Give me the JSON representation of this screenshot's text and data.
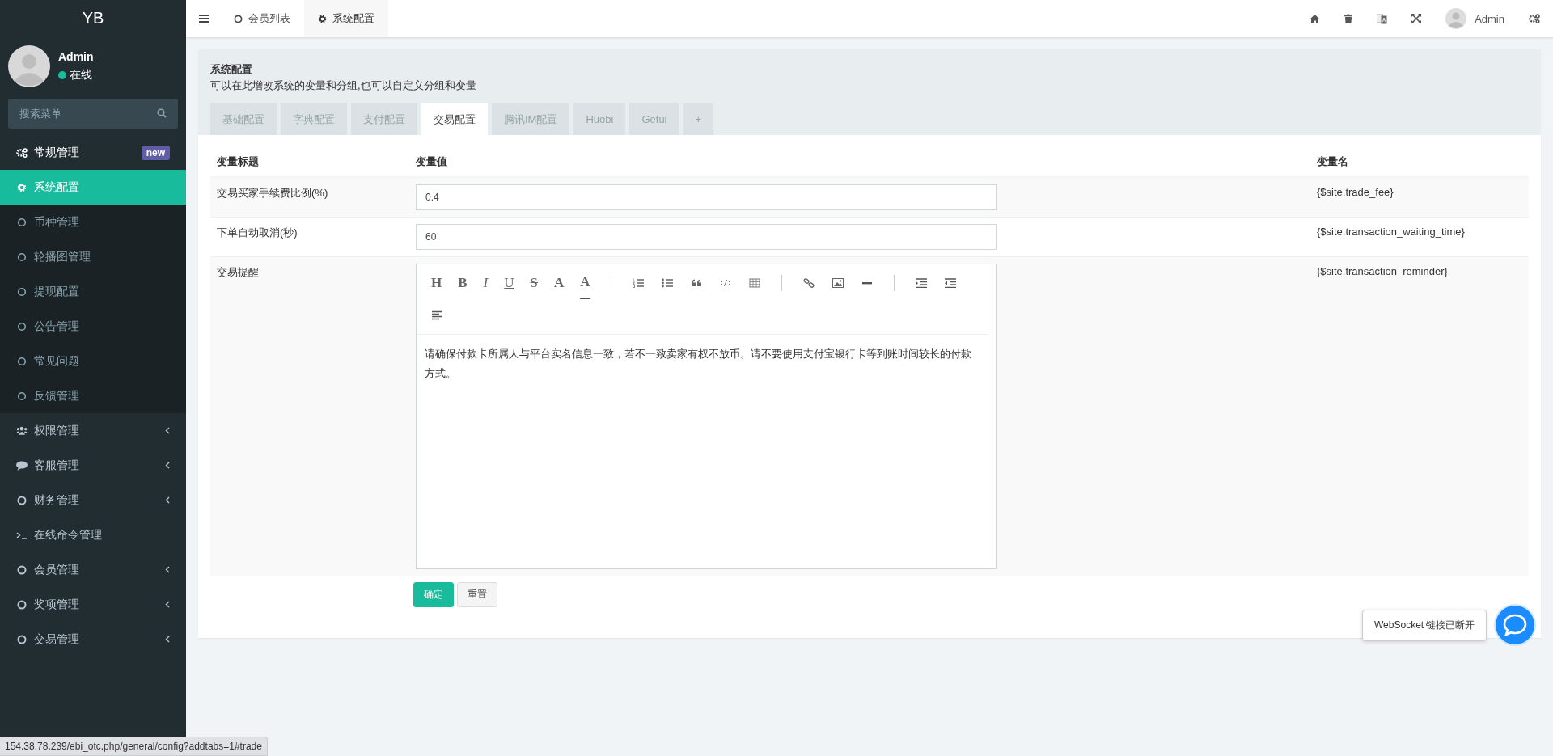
{
  "sidebar": {
    "logo": "YB",
    "user": {
      "name": "Admin",
      "status": "在线",
      "online": true
    },
    "search": {
      "placeholder": "搜索菜单"
    },
    "menu": [
      {
        "label": "常规管理",
        "kind": "group",
        "badge": "new",
        "expanded": true,
        "children": [
          {
            "label": "系统配置",
            "selected": true
          },
          {
            "label": "币种管理",
            "selected": false
          },
          {
            "label": "轮播图管理",
            "selected": false
          },
          {
            "label": "提现配置",
            "selected": false
          },
          {
            "label": "公告管理",
            "selected": false
          },
          {
            "label": "常见问题",
            "selected": false
          },
          {
            "label": "反馈管理",
            "selected": false
          }
        ]
      },
      {
        "label": "权限管理",
        "kind": "group",
        "expanded": false
      },
      {
        "label": "客服管理",
        "kind": "group",
        "expanded": false
      },
      {
        "label": "财务管理",
        "kind": "group",
        "expanded": false
      },
      {
        "label": "在线命令管理",
        "kind": "link"
      },
      {
        "label": "会员管理",
        "kind": "group",
        "expanded": false
      },
      {
        "label": "奖项管理",
        "kind": "group",
        "expanded": false
      },
      {
        "label": "交易管理",
        "kind": "group",
        "expanded": false
      }
    ]
  },
  "topbar": {
    "tabs": [
      {
        "label": "会员列表",
        "selected": false
      },
      {
        "label": "系统配置",
        "selected": true
      }
    ],
    "user": "Admin"
  },
  "page": {
    "title": "系统配置",
    "description": "可以在此增改系统的变量和分组,也可以自定义分组和变量",
    "tabs": [
      {
        "label": "基础配置",
        "selected": false
      },
      {
        "label": "字典配置",
        "selected": false
      },
      {
        "label": "支付配置",
        "selected": false
      },
      {
        "label": "交易配置",
        "selected": true
      },
      {
        "label": "腾讯IM配置",
        "selected": false
      },
      {
        "label": "Huobi",
        "selected": false
      },
      {
        "label": "Getui",
        "selected": false
      },
      {
        "label": "+",
        "selected": false
      }
    ],
    "table": {
      "columns": [
        "变量标题",
        "变量值",
        "变量名"
      ],
      "rows": [
        {
          "title": "交易买家手续费比例(%)",
          "kind": "input",
          "value": "0.4",
          "variable": "{$site.trade_fee}"
        },
        {
          "title": "下单自动取消(秒)",
          "kind": "input",
          "value": "60",
          "variable": "{$site.transaction_waiting_time}"
        },
        {
          "title": "交易提醒",
          "kind": "editor",
          "value": "请确保付款卡所属人与平台实名信息一致，若不一致卖家有权不放币。请不要使用支付宝银行卡等到账时间较长的付款方式。",
          "variable": "{$site.transaction_reminder}",
          "toolbar": [
            {
              "kind": "heading",
              "label": "H"
            },
            {
              "kind": "bold",
              "label": "B"
            },
            {
              "kind": "italic",
              "label": "I"
            },
            {
              "kind": "underline",
              "label": "U"
            },
            {
              "kind": "strike",
              "label": "S"
            },
            {
              "kind": "font",
              "label": "A"
            },
            {
              "kind": "color",
              "label": "A"
            },
            {
              "kind": "separator"
            },
            {
              "kind": "ordered"
            },
            {
              "kind": "bulleted"
            },
            {
              "kind": "quote"
            },
            {
              "kind": "code"
            },
            {
              "kind": "table"
            },
            {
              "kind": "separator"
            },
            {
              "kind": "link"
            },
            {
              "kind": "image"
            },
            {
              "kind": "rule"
            },
            {
              "kind": "separator"
            },
            {
              "kind": "indent"
            },
            {
              "kind": "outdent"
            },
            {
              "kind": "align"
            }
          ]
        }
      ]
    },
    "buttons": [
      {
        "label": "确定",
        "kind": "primary"
      },
      {
        "label": "重置",
        "kind": "default"
      }
    ]
  },
  "toast": {
    "message": "WebSocket 链接已断开"
  },
  "status_bar": {
    "url": "154.38.78.239/ebi_otc.php/general/config?addtabs=1#trade"
  }
}
